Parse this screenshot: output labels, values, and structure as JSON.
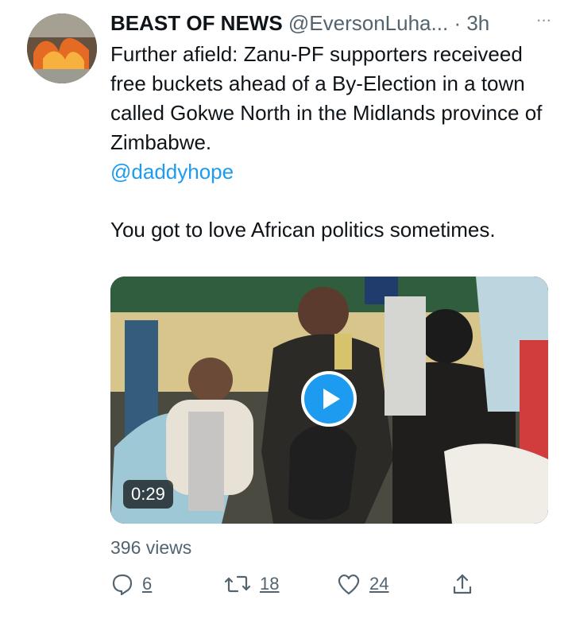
{
  "tweet": {
    "author_name": "BEAST OF NEWS",
    "author_handle": "@EversonLuha...",
    "separator": "·",
    "timestamp": "3h",
    "more_label": "···",
    "text_line_1": "Further afield: Zanu-PF supporters receiveed free buckets ahead of a By-Election in a town called Gokwe North in the Midlands province of Zimbabwe.",
    "mention": "@daddyhope",
    "text_line_2": "You got to love African politics sometimes.",
    "video_duration": "0:29",
    "views": "396 views",
    "reply_count": "6",
    "retweet_count": "18",
    "like_count": "24",
    "accent_color": "#1d9bf0"
  }
}
